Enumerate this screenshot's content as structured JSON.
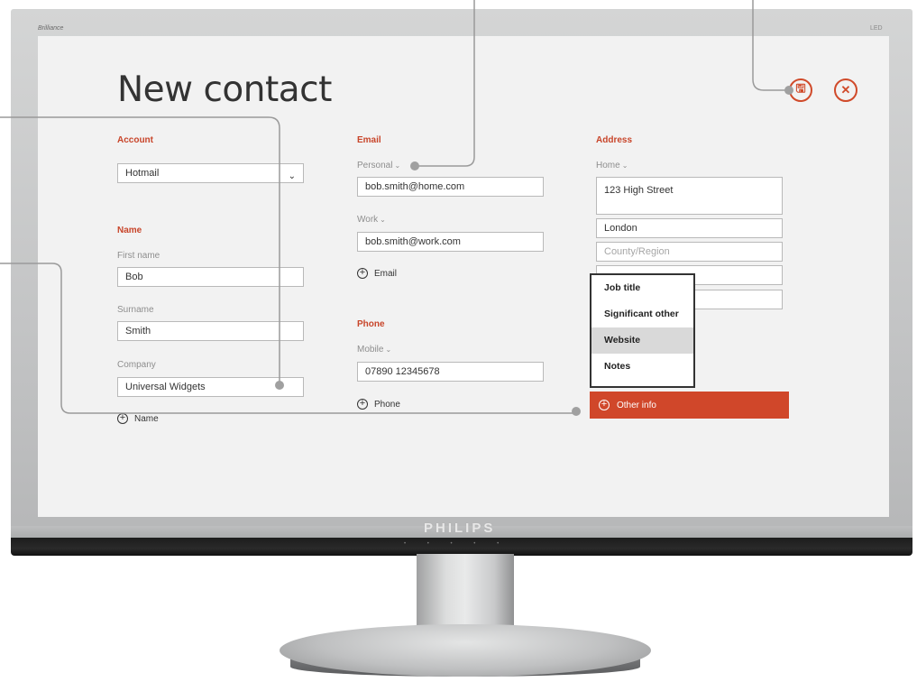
{
  "monitor": {
    "brand": "Brilliance",
    "led_mark": "LED",
    "logo": "PHILIPS",
    "controls": "• • • • •"
  },
  "page": {
    "title": "New contact"
  },
  "actions": {
    "save_icon": "floppy-save-icon",
    "save_glyph": "🖫",
    "close_icon": "close-icon",
    "close_glyph": "✕",
    "accent_color": "#d04a2a"
  },
  "account": {
    "label": "Account",
    "selected": "Hotmail",
    "arrow": "⌄"
  },
  "name": {
    "label": "Name",
    "first_label": "First name",
    "first_value": "Bob",
    "surname_label": "Surname",
    "surname_value": "Smith",
    "company_label": "Company",
    "company_value": "Universal Widgets",
    "add_label": "Name"
  },
  "email": {
    "label": "Email",
    "personal_label": "Personal",
    "personal_value": "bob.smith@home.com",
    "work_label": "Work",
    "work_value": "bob.smith@work.com",
    "add_label": "Email"
  },
  "phone": {
    "label": "Phone",
    "mobile_label": "Mobile",
    "mobile_value": "07890 12345678",
    "add_label": "Phone"
  },
  "address": {
    "label": "Address",
    "type_label": "Home",
    "street_value": "123 High Street",
    "city_value": "London",
    "county_placeholder": "County/Region"
  },
  "other_info": {
    "menu_items": [
      "Job title",
      "Significant other",
      "Website",
      "Notes"
    ],
    "hovered_item": "Website",
    "button_label": "Other info"
  }
}
